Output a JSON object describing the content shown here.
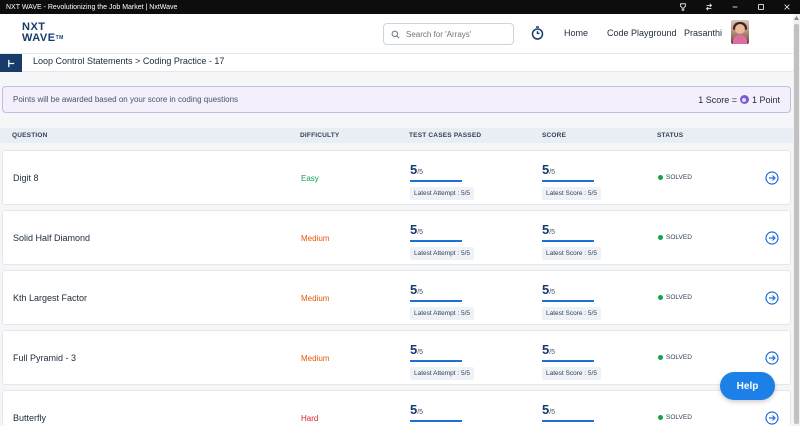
{
  "window": {
    "title": "NXT WAVE - Revolutionizing the Job Market | NxtWave"
  },
  "header": {
    "logo_line1": "NXT",
    "logo_line2": "WAVE",
    "logo_tm": "TM",
    "search_placeholder": "Search for 'Arrays'",
    "nav_home": "Home",
    "nav_code": "Code Playground",
    "user_name": "Prasanthi"
  },
  "breadcrumb": "Loop Control Statements > Coding Practice - 17",
  "banner": {
    "message": "Points will be awarded based on your score in coding questions",
    "score_label": "1 Score =",
    "point_label": "1 Point"
  },
  "table": {
    "headers": {
      "question": "QUESTION",
      "difficulty": "DIFFICULTY",
      "tests": "TEST CASES PASSED",
      "score": "SCORE",
      "status": "STATUS"
    },
    "rows": [
      {
        "name": "Digit 8",
        "difficulty": "Easy",
        "tests_big": "5",
        "tests_small": "/5",
        "tests_tag": "Latest Attempt : 5/5",
        "score_big": "5",
        "score_small": "/5",
        "score_tag": "Latest Score : 5/5",
        "status": "SOLVED"
      },
      {
        "name": "Solid Half Diamond",
        "difficulty": "Medium",
        "tests_big": "5",
        "tests_small": "/5",
        "tests_tag": "Latest Attempt : 5/5",
        "score_big": "5",
        "score_small": "/5",
        "score_tag": "Latest Score : 5/5",
        "status": "SOLVED"
      },
      {
        "name": "Kth Largest Factor",
        "difficulty": "Medium",
        "tests_big": "5",
        "tests_small": "/5",
        "tests_tag": "Latest Attempt : 5/5",
        "score_big": "5",
        "score_small": "/5",
        "score_tag": "Latest Score : 5/5",
        "status": "SOLVED"
      },
      {
        "name": "Full Pyramid - 3",
        "difficulty": "Medium",
        "tests_big": "5",
        "tests_small": "/5",
        "tests_tag": "Latest Attempt : 5/5",
        "score_big": "5",
        "score_small": "/5",
        "score_tag": "Latest Score : 5/5",
        "status": "SOLVED"
      },
      {
        "name": "Butterfly",
        "difficulty": "Hard",
        "tests_big": "5",
        "tests_small": "/5",
        "tests_tag": "",
        "score_big": "5",
        "score_small": "/5",
        "score_tag": "",
        "status": "SOLVED"
      }
    ]
  },
  "help_label": "Help",
  "colors": {
    "brand_navy": "#183b6b",
    "accent_blue": "#1d6fd6",
    "help_blue": "#1d80e6",
    "easy": "#16a34a",
    "medium": "#ea580c",
    "hard": "#dc2626",
    "banner_bg": "#f3effb"
  },
  "icons": [
    "search-icon",
    "timer-icon",
    "sidebar-toggle-icon",
    "point-coin-icon",
    "arrow-right-circle-icon",
    "minimize-icon",
    "maximize-icon",
    "close-icon",
    "pin-icon",
    "swap-icon"
  ]
}
